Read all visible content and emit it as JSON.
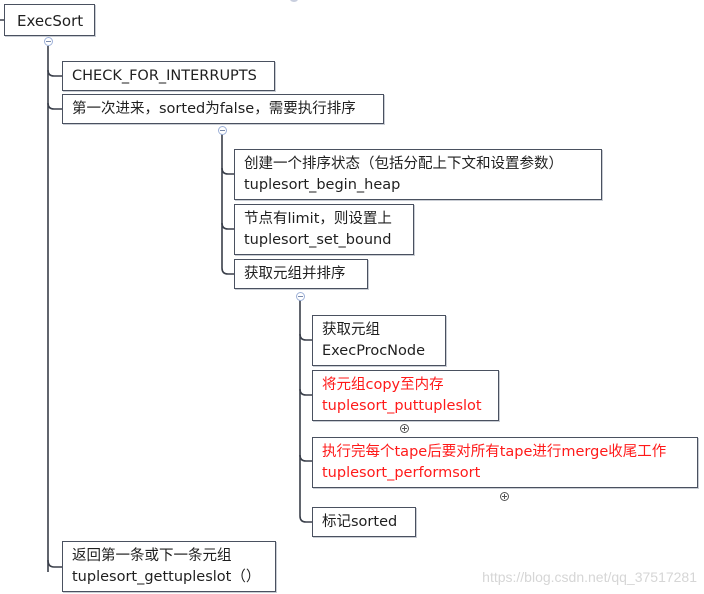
{
  "root": {
    "label": "ExecSort"
  },
  "level1": [
    {
      "lines": [
        "CHECK_FOR_INTERRUPTS"
      ],
      "color": "default"
    },
    {
      "lines": [
        "第一次进来，sorted为false，需要执行排序"
      ],
      "color": "default"
    },
    {
      "lines": [
        "返回第一条或下一条元组",
        "tuplesort_gettupleslot（）"
      ],
      "color": "default"
    }
  ],
  "level2": [
    {
      "lines": [
        "创建一个排序状态（包括分配上下文和设置参数）",
        "tuplesort_begin_heap"
      ],
      "color": "default"
    },
    {
      "lines": [
        "节点有limit，则设置上",
        "tuplesort_set_bound"
      ],
      "color": "default"
    },
    {
      "lines": [
        "获取元组并排序"
      ],
      "color": "default"
    }
  ],
  "level3": [
    {
      "lines": [
        "获取元组",
        "ExecProcNode"
      ],
      "color": "default"
    },
    {
      "lines": [
        "将元组copy至内存",
        "tuplesort_puttupleslot"
      ],
      "color": "red",
      "collapsed": true
    },
    {
      "lines": [
        "执行完每个tape后要对所有tape进行merge收尾工作",
        "tuplesort_performsort"
      ],
      "color": "red",
      "collapsed": true
    },
    {
      "lines": [
        "标记sorted"
      ],
      "color": "default"
    }
  ],
  "colors": {
    "highlight": "#ff1a1a",
    "text": "#1f1f1f",
    "border": "#4a5160",
    "connector": "#3a3f4a"
  },
  "icons": {
    "expanded": "collapse-minus-icon",
    "collapsed": "expand-plus-icon"
  },
  "watermark": "https://blog.csdn.net/qq_37517281"
}
